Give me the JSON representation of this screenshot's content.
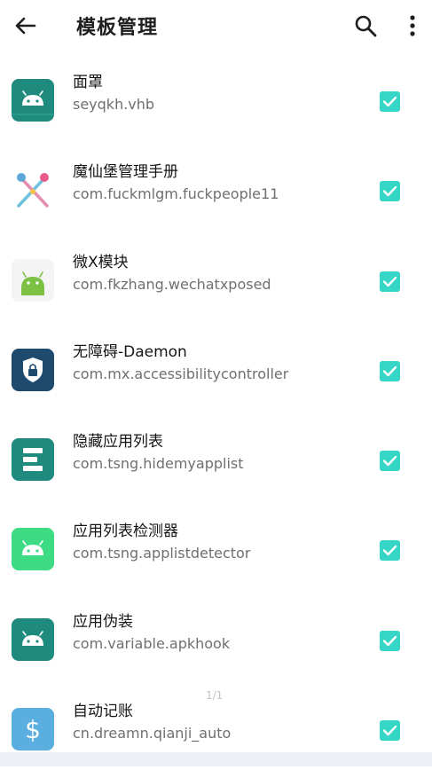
{
  "appbar": {
    "title": "模板管理",
    "back_icon": "arrow-left-icon",
    "search_icon": "search-icon",
    "more_icon": "more-vert-icon"
  },
  "modules": [
    {
      "name": "面罩",
      "package": "seyqkh.vhb",
      "icon": "android-teal-icon",
      "checked": true
    },
    {
      "name": "魔仙堡管理手册",
      "package": "com.fuckmlgm.fuckpeople11",
      "icon": "wand-icon",
      "checked": true
    },
    {
      "name": "微X模块",
      "package": "com.fkzhang.wechatxposed",
      "icon": "android-green-icon",
      "checked": true
    },
    {
      "name": "无障碍-Daemon",
      "package": "com.mx.accessibilitycontroller",
      "icon": "shield-lock-icon",
      "checked": true
    },
    {
      "name": "隐藏应用列表",
      "package": "com.tsng.hidemyapplist",
      "icon": "list-blocks-icon",
      "checked": true
    },
    {
      "name": "应用列表检测器",
      "package": "com.tsng.applistdetector",
      "icon": "android-green-icon",
      "checked": true
    },
    {
      "name": "应用伪装",
      "package": "com.variable.apkhook",
      "icon": "android-teal-icon",
      "checked": true
    },
    {
      "name": "自动记账",
      "package": "cn.dreamn.qianji_auto",
      "icon": "dollar-icon",
      "checked": true
    }
  ],
  "pager": "1/1",
  "colors": {
    "checkbox": "#36d6c7",
    "teal_icon": "#1f8a7e",
    "green_icon": "#3ddc84",
    "navy_icon": "#1e4a6e"
  }
}
